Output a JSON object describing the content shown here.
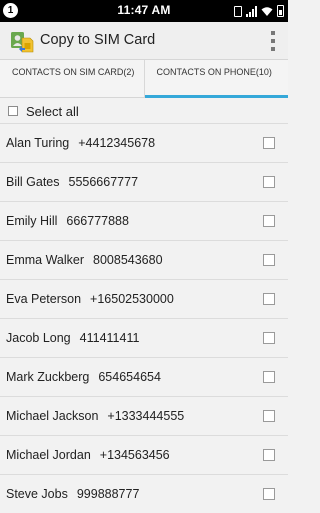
{
  "status_bar": {
    "notification_badge": "1",
    "time": "11:47 AM",
    "icons": [
      "vibrate-icon",
      "signal-icon",
      "wifi-icon",
      "battery-icon"
    ]
  },
  "action_bar": {
    "title": "Copy to SIM Card",
    "icons": [
      "contacts-sim-app-icon",
      "overflow-menu-icon"
    ]
  },
  "tabs": [
    {
      "label": "CONTACTS ON SIM CARD(2)",
      "active": false
    },
    {
      "label": "CONTACTS ON PHONE(10)",
      "active": true
    }
  ],
  "select_all": {
    "label": "Select all",
    "checked": false
  },
  "contacts": [
    {
      "name": "Alan Turing",
      "phone": "+4412345678",
      "checked": false
    },
    {
      "name": "Bill Gates",
      "phone": "5556667777",
      "checked": false
    },
    {
      "name": "Emily Hill",
      "phone": "666777888",
      "checked": false
    },
    {
      "name": "Emma Walker",
      "phone": "8008543680",
      "checked": false
    },
    {
      "name": "Eva Peterson",
      "phone": "+16502530000",
      "checked": false
    },
    {
      "name": "Jacob Long",
      "phone": "411411411",
      "checked": false
    },
    {
      "name": "Mark Zuckberg",
      "phone": "654654654",
      "checked": false
    },
    {
      "name": "Michael Jackson",
      "phone": "+1333444555",
      "checked": false
    },
    {
      "name": "Michael Jordan",
      "phone": "+134563456",
      "checked": false
    },
    {
      "name": "Steve Jobs",
      "phone": "999888777",
      "checked": false
    }
  ],
  "colors": {
    "tab_indicator": "#35a8d9",
    "status_bar": "#000000",
    "background": "#f2f2f2"
  }
}
